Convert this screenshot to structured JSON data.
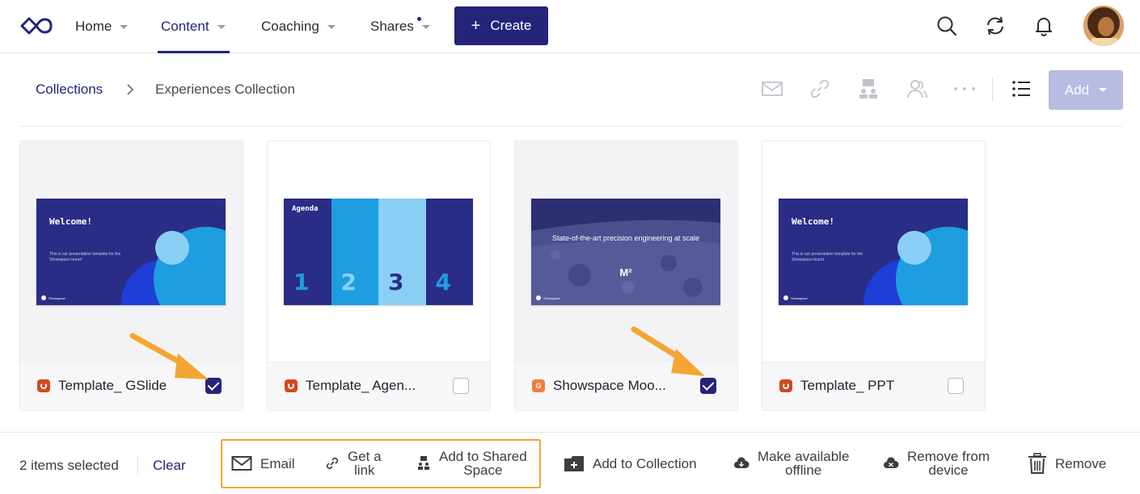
{
  "nav": {
    "items": [
      {
        "label": "Home"
      },
      {
        "label": "Content"
      },
      {
        "label": "Coaching"
      },
      {
        "label": "Shares"
      }
    ],
    "create_label": "Create"
  },
  "breadcrumb": {
    "parent": "Collections",
    "current": "Experiences Collection"
  },
  "toolbar": {
    "add_label": "Add"
  },
  "cards": [
    {
      "title": "Template_ GSlide",
      "file_type": "presentation",
      "checked": true,
      "thumb": {
        "heading": "Welcome!",
        "body": "This is our presentation template for the Showspace brand",
        "brand": "Showspace"
      }
    },
    {
      "title": "Template_ Agen...",
      "file_type": "presentation",
      "checked": false,
      "thumb": {
        "heading": "Agenda",
        "numbers": [
          "1",
          "2",
          "3",
          "4"
        ],
        "brand": "Showspace"
      }
    },
    {
      "title": "Showspace Moo...",
      "file_type": "google-slides",
      "file_badge": "G",
      "checked": true,
      "thumb": {
        "heading": "State-of-the-art precision engineering at scale",
        "mark": "M²",
        "brand": "Showspace"
      }
    },
    {
      "title": "Template_ PPT",
      "file_type": "presentation",
      "checked": false,
      "thumb": {
        "heading": "Welcome!",
        "body": "This is our presentation template for the Showspace brand",
        "brand": "Showspace"
      }
    }
  ],
  "bottom_bar": {
    "selection": "2 items selected",
    "clear_label": "Clear",
    "actions": {
      "email": "Email",
      "get_link_1": "Get a",
      "get_link_2": "link",
      "shared_space_1": "Add to Shared",
      "shared_space_2": "Space",
      "collection": "Add to Collection",
      "offline_1": "Make available",
      "offline_2": "offline",
      "remove_device_1": "Remove from",
      "remove_device_2": "device",
      "remove": "Remove"
    }
  },
  "colors": {
    "brand": "#23247a",
    "highlight": "#f5a533",
    "add_disabled": "#b8bbe2",
    "slide_bg": "#2a2d86"
  }
}
